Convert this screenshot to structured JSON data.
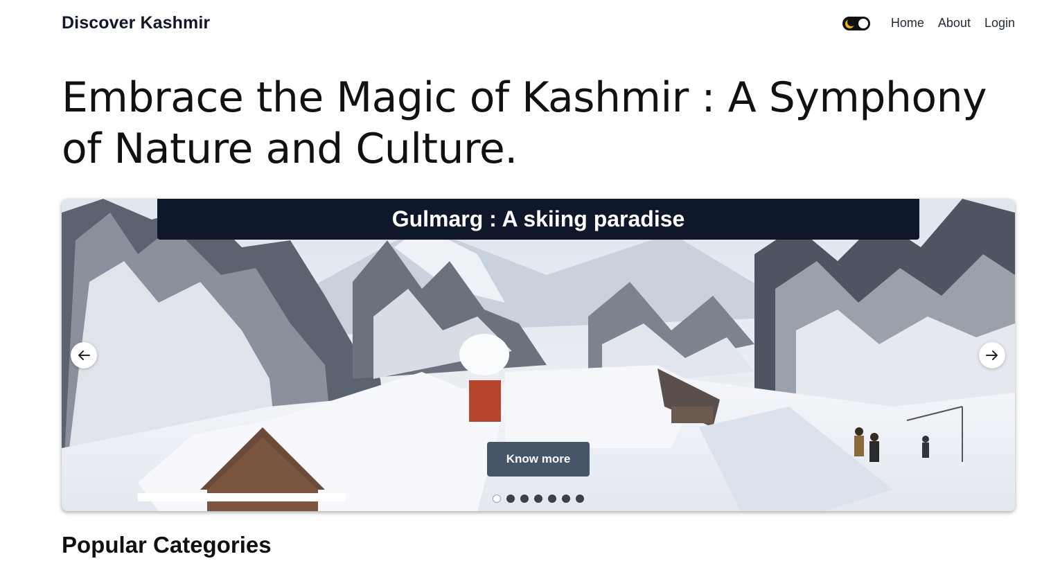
{
  "nav": {
    "brand": "Discover Kashmir",
    "links": [
      "Home",
      "About",
      "Login"
    ]
  },
  "hero": {
    "title": "Embrace the Magic of Kashmir : A Symphony of Nature and Culture."
  },
  "carousel": {
    "slide_title": "Gulmarg : A skiing paradise",
    "button_label": "Know more",
    "slide_count": 7,
    "active_index": 0
  },
  "section": {
    "title": "Popular Categories"
  },
  "colors": {
    "caption_bar": "#0f172a",
    "button": "#475569",
    "toggle_moon": "#f5b301"
  },
  "icons": {
    "toggle": "theme-toggle-icon",
    "prev": "arrow-left-icon",
    "next": "arrow-right-icon"
  }
}
